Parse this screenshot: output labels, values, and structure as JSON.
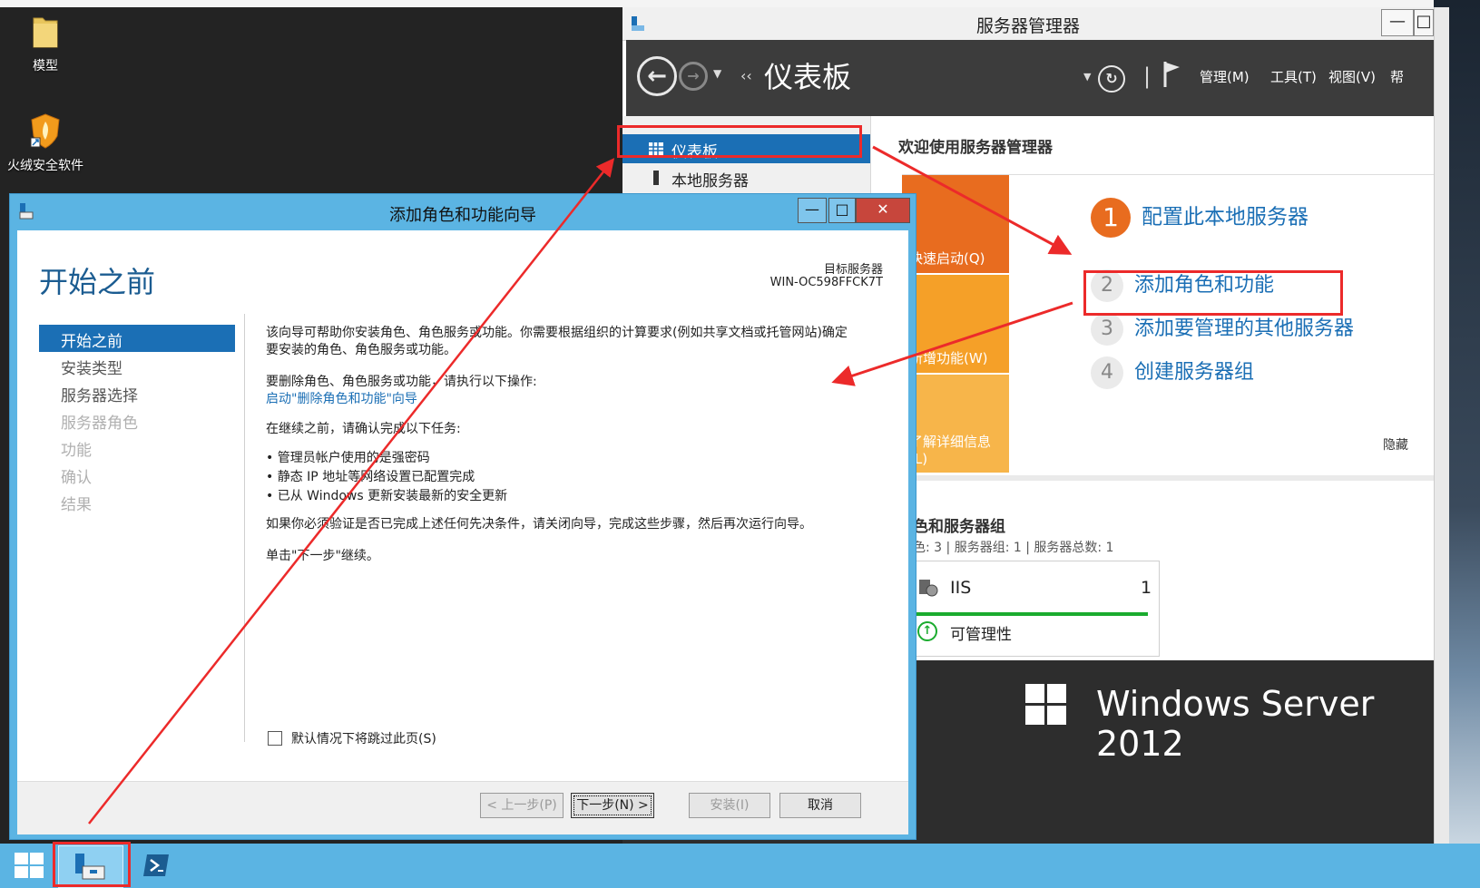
{
  "desktop": {
    "icons": [
      {
        "label": "模型",
        "icon": "folder-icon"
      },
      {
        "label": "火绒安全软件",
        "icon": "huorong-shield-icon"
      }
    ]
  },
  "server_manager": {
    "title": "服务器管理器",
    "nav_title": "仪表板",
    "menus": [
      "管理(M)",
      "工具(T)",
      "视图(V)",
      "帮"
    ],
    "left_nav": [
      "仪表板",
      "本地服务器"
    ],
    "welcome": "欢迎使用服务器管理器",
    "quick_tiles": [
      "快速启动(Q)",
      "新增功能(W)",
      "了解详细信息(L)"
    ],
    "steps": [
      {
        "num": "1",
        "label": "配置此本地服务器"
      },
      {
        "num": "2",
        "label": "添加角色和功能"
      },
      {
        "num": "3",
        "label": "添加要管理的其他服务器"
      },
      {
        "num": "4",
        "label": "创建服务器组"
      }
    ],
    "hide_label": "隐藏",
    "roles_heading": "色和服务器组",
    "roles_summary": "色: 3 | 服务器组: 1 | 服务器总数: 1",
    "iis": {
      "name": "IIS",
      "count": "1",
      "status": "可管理性"
    },
    "brand": "Windows Server 2012"
  },
  "wizard": {
    "title": "添加角色和功能向导",
    "page_title": "开始之前",
    "target_label": "目标服务器",
    "target_value": "WIN-OC598FFCK7T",
    "steps": [
      "开始之前",
      "安装类型",
      "服务器选择",
      "服务器角色",
      "功能",
      "确认",
      "结果"
    ],
    "intro_line1": "该向导可帮助你安装角色、角色服务或功能。你需要根据组织的计算要求(例如共享文档或托管网站)确定",
    "intro_line2": "要安装的角色、角色服务或功能。",
    "remove_text": "要删除角色、角色服务或功能，请执行以下操作:",
    "remove_link": "启动\"删除角色和功能\"向导",
    "before_text": "在继续之前，请确认完成以下任务:",
    "bullets": [
      "管理员帐户使用的是强密码",
      "静态 IP 地址等网络设置已配置完成",
      "已从 Windows 更新安装最新的安全更新"
    ],
    "verify_text": "如果你必须验证是否已完成上述任何先决条件，请关闭向导，完成这些步骤，然后再次运行向导。",
    "next_hint": "单击\"下一步\"继续。",
    "skip_checkbox": "默认情况下将跳过此页(S)",
    "skip_checked": false,
    "buttons": {
      "prev": "< 上一步(P)",
      "next": "下一步(N) >",
      "install": "安装(I)",
      "cancel": "取消"
    }
  },
  "colors": {
    "accent": "#1b6fb5",
    "window_frame": "#5bb4e3",
    "annotation": "#ec2a2a",
    "quickstart": "#e86c1f"
  }
}
